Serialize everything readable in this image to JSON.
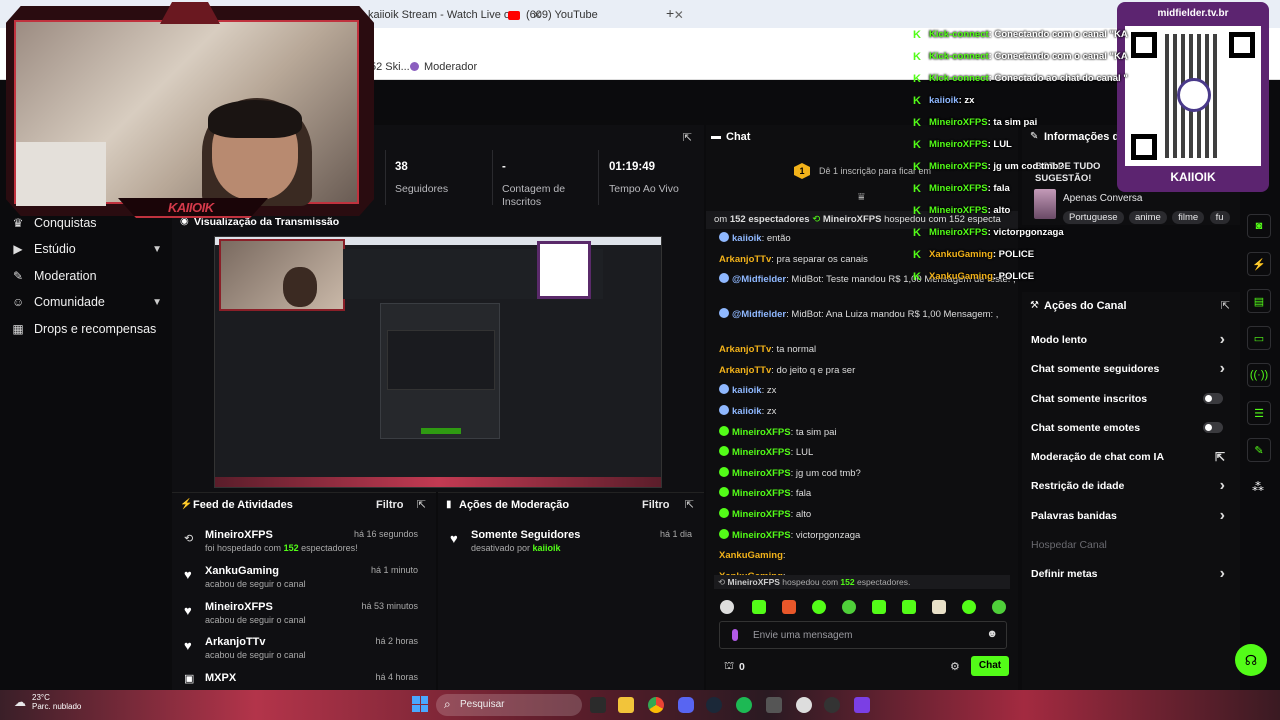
{
  "browser": {
    "tabs": [
      {
        "label": "kaiioik Stream - Watch Live on"
      },
      {
        "label": "(609) YouTube"
      }
    ],
    "bookmark_partial": "52 Ski...",
    "bookmark_moderador": "Moderador"
  },
  "sidebar": {
    "items": [
      {
        "label": "Conquistas"
      },
      {
        "label": "Estúdio"
      },
      {
        "label": "Moderation"
      },
      {
        "label": "Comunidade"
      },
      {
        "label": "Drops e recompensas"
      }
    ]
  },
  "stats": [
    {
      "value": "38",
      "label": "Seguidores"
    },
    {
      "value": "-",
      "label": "Contagem de Inscritos"
    },
    {
      "value": "01:19:49",
      "label": "Tempo Ao Vivo"
    }
  ],
  "preview": {
    "title": "Visualização da Transmissão"
  },
  "activity_feed": {
    "title": "Feed de Atividades",
    "filter_label": "Filtro",
    "items": [
      {
        "name": "MineiroXFPS",
        "time": "há 16 segundos",
        "sub_pre": "foi hospedado com ",
        "sub_num": "152",
        "sub_post": " espectadores!"
      },
      {
        "name": "XankuGaming",
        "time": "há 1 minuto",
        "sub": "acabou de seguir o canal"
      },
      {
        "name": "MineiroXFPS",
        "time": "há 53 minutos",
        "sub": "acabou de seguir o canal"
      },
      {
        "name": "ArkanjoTTv",
        "time": "há 2 horas",
        "sub": "acabou de seguir o canal"
      },
      {
        "name": "MXPX",
        "time": "há 4 horas",
        "sub": ""
      }
    ]
  },
  "mod_actions": {
    "title": "Ações de Moderação",
    "filter_label": "Filtro",
    "items": [
      {
        "name": "Somente Seguidores",
        "time": "há 1 dia",
        "sub_pre": "desativado por ",
        "sub_user": "kaiioik"
      }
    ]
  },
  "chat": {
    "title": "Chat",
    "subscribe_prompt": "Dê 1 inscrição para ficar em",
    "sub_count": "1",
    "host_banner_pre": "om ",
    "host_banner_num": "152 espectadores",
    "host_banner_user": "MineiroXFPS",
    "host_banner_post": " hospedou com 152 especta",
    "messages": [
      {
        "user": "kaiioik",
        "text": ": então",
        "color": "blue"
      },
      {
        "user": "ArkanjoTTv",
        "text": ": pra separar os canais",
        "color": "orange"
      },
      {
        "user": "@Midfielder",
        "text": ": MidBot: Teste mandou R$ 1,00 Mensagem de teste! ,",
        "color": "blue"
      },
      {
        "user": "@Midfielder",
        "text": ": MidBot: Ana Luiza mandou R$ 1,00 Mensagem: ,",
        "color": "blue"
      },
      {
        "user": "ArkanjoTTv",
        "text": ": ta normal",
        "color": "orange"
      },
      {
        "user": "ArkanjoTTv",
        "text": ": do jeito q e pra ser",
        "color": "orange"
      },
      {
        "user": "kaiioik",
        "text": ": zx",
        "color": "blue"
      },
      {
        "user": "kaiioik",
        "text": ": zx",
        "color": "blue"
      },
      {
        "user": "MineiroXFPS",
        "text": ": ta sim pai",
        "color": "green"
      },
      {
        "user": "MineiroXFPS",
        "text": ": LUL",
        "color": "green"
      },
      {
        "user": "MineiroXFPS",
        "text": ": jg um cod tmb?",
        "color": "green"
      },
      {
        "user": "MineiroXFPS",
        "text": ": fala",
        "color": "green"
      },
      {
        "user": "MineiroXFPS",
        "text": ": alto",
        "color": "green"
      },
      {
        "user": "MineiroXFPS",
        "text": ": victorpgonzaga",
        "color": "green"
      },
      {
        "user": "XankuGaming",
        "text": ":",
        "color": "orange"
      },
      {
        "user": "XankuGaming",
        "text": ":",
        "color": "orange"
      }
    ],
    "footer_host_user": "MineiroXFPS",
    "footer_host_mid": " hospedou com ",
    "footer_host_num": "152",
    "footer_host_post": " espectadores.",
    "input_placeholder": "Envie uma mensagem",
    "points": "0",
    "send_label": "Chat"
  },
  "channel_info": {
    "title": "Informações da",
    "suggestion": "BOT DE TUDO SUGESTÃO!",
    "category": "Apenas Conversa",
    "tags": [
      "Portuguese",
      "anime",
      "filme",
      "fu"
    ]
  },
  "channel_actions": {
    "title": "Ações do Canal",
    "rows": [
      {
        "label": "Modo lento",
        "control": "chevron"
      },
      {
        "label": "Chat somente seguidores",
        "control": "chevron"
      },
      {
        "label": "Chat somente inscritos",
        "control": "toggle"
      },
      {
        "label": "Chat somente emotes",
        "control": "toggle"
      },
      {
        "label": "Moderação de chat com IA",
        "control": "external"
      },
      {
        "label": "Restrição de idade",
        "control": "chevron"
      },
      {
        "label": "Palavras banidas",
        "control": "chevron"
      },
      {
        "label": "Hospedar Canal",
        "control": "none"
      },
      {
        "label": "Definir metas",
        "control": "chevron"
      }
    ]
  },
  "overlay": {
    "webcam_name": "KAIIOIK",
    "qr_url": "midfielder.tv.br",
    "qr_name": "KAIIOIK",
    "feed": [
      {
        "user": "Kick-connect",
        "text": ": Conectando com o canal \"KA",
        "color": "kick"
      },
      {
        "user": "Kick-connect",
        "text": ": Conectando com o canal \"KA",
        "color": "kick"
      },
      {
        "user": "Kick-connect",
        "text": ": Conectado ao chat do canal \"",
        "color": "kick"
      },
      {
        "user": "kaiioik",
        "text": ": zx",
        "color": "blue"
      },
      {
        "user": "MineiroXFPS",
        "text": ": ta sim pai",
        "color": "green"
      },
      {
        "user": "MineiroXFPS",
        "text": ": LUL",
        "color": "green"
      },
      {
        "user": "MineiroXFPS",
        "text": ": jg um cod tmb?",
        "color": "green"
      },
      {
        "user": "MineiroXFPS",
        "text": ": fala",
        "color": "green"
      },
      {
        "user": "MineiroXFPS",
        "text": ": alto",
        "color": "green"
      },
      {
        "user": "MineiroXFPS",
        "text": ": victorpgonzaga",
        "color": "green"
      },
      {
        "user": "XankuGaming",
        "text": ": POLICE",
        "color": "orange"
      },
      {
        "user": "XankuGaming",
        "text": ": POLICE",
        "color": "orange"
      }
    ]
  },
  "taskbar": {
    "weather_temp": "23°C",
    "weather_desc": "Parc. nublado",
    "search_placeholder": "Pesquisar"
  },
  "colors": {
    "accent": "#53fc18",
    "orange": "#f2b21a",
    "blue": "#8fb8ff"
  }
}
